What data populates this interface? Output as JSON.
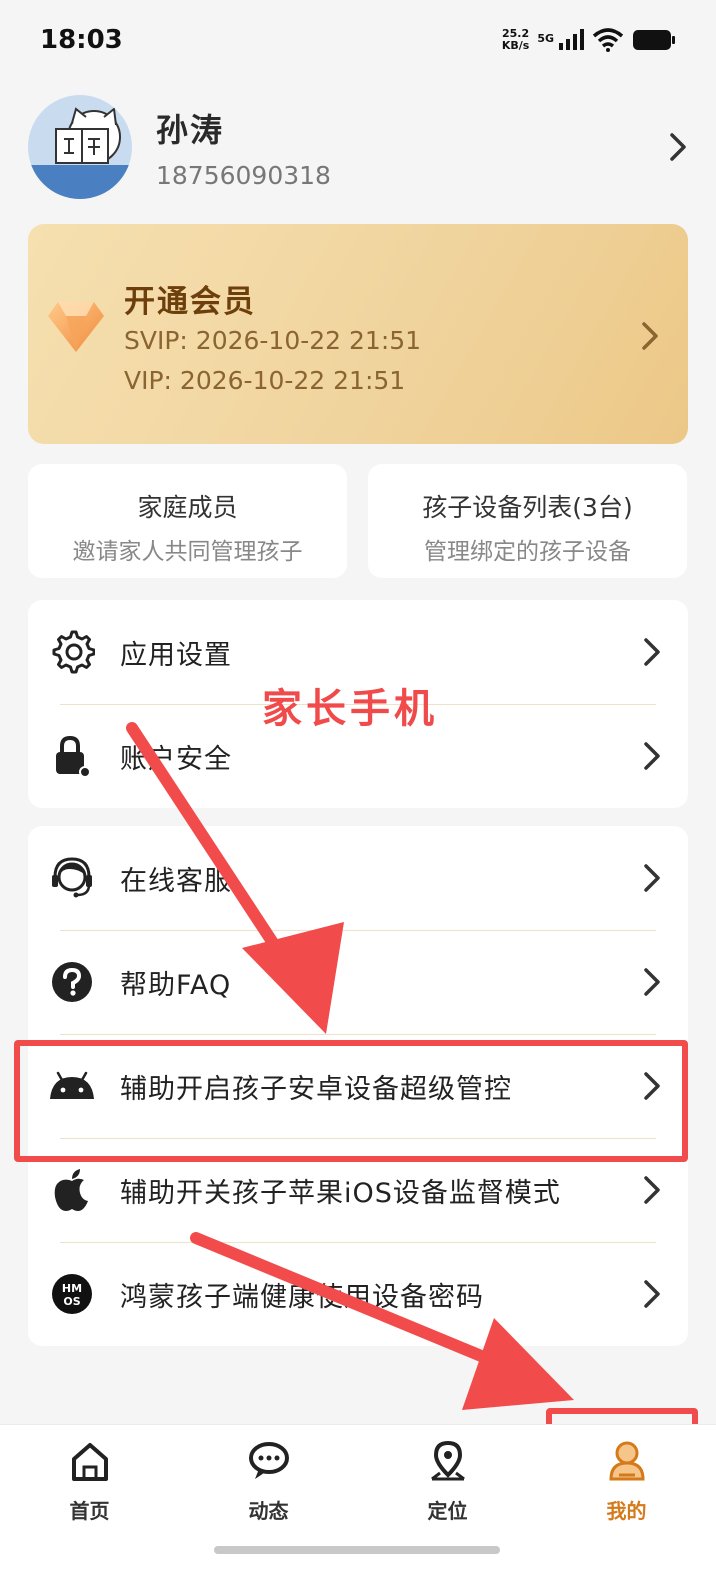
{
  "status": {
    "time": "18:03",
    "speed_value": "25.2",
    "speed_unit": "KB/s",
    "network": "5G"
  },
  "profile": {
    "name": "孙涛",
    "phone": "18756090318"
  },
  "vip": {
    "title": "开通会员",
    "svip": "SVIP: 2026-10-22 21:51",
    "vip": "VIP: 2026-10-22 21:51"
  },
  "quick": [
    {
      "title": "家庭成员",
      "subtitle": "邀请家人共同管理孩子"
    },
    {
      "title": "孩子设备列表(3台)",
      "subtitle": "管理绑定的孩子设备"
    }
  ],
  "menu_group_1": [
    {
      "label": "应用设置",
      "icon": "gear-icon"
    },
    {
      "label": "账户安全",
      "icon": "lock-icon"
    }
  ],
  "menu_group_2": [
    {
      "label": "在线客服",
      "icon": "headset-agent-icon"
    },
    {
      "label": "帮助FAQ",
      "icon": "question-icon"
    },
    {
      "label": "辅助开启孩子安卓设备超级管控",
      "icon": "android-icon"
    },
    {
      "label": "辅助开关孩子苹果iOS设备监督模式",
      "icon": "apple-icon"
    },
    {
      "label": "鸿蒙孩子端健康使用设备密码",
      "icon": "hmos-icon"
    }
  ],
  "hmos_logo_text": "HMOS",
  "annotation": {
    "text": "家长手机",
    "color": "#f04a4a"
  },
  "tabs": [
    {
      "label": "首页",
      "icon": "home-icon",
      "active": false
    },
    {
      "label": "动态",
      "icon": "chat-bubble-icon",
      "active": false
    },
    {
      "label": "定位",
      "icon": "location-pin-icon",
      "active": false
    },
    {
      "label": "我的",
      "icon": "person-icon",
      "active": true
    }
  ],
  "colors": {
    "accent": "#d47a1a",
    "vip_title": "#6d3f0c",
    "annotation_red": "#f24b4b"
  }
}
